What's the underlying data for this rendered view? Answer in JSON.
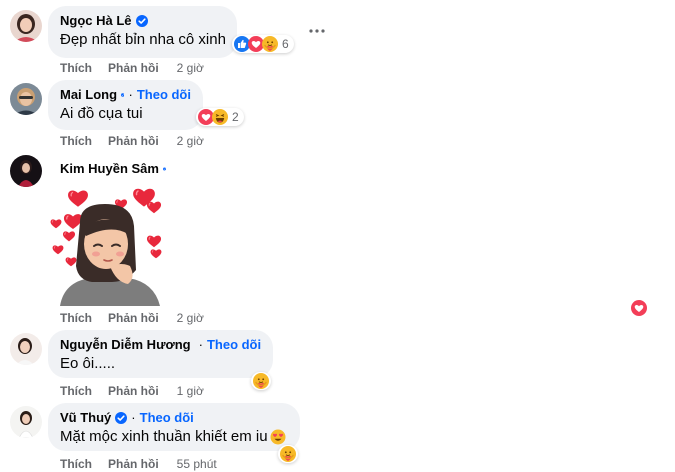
{
  "comments": [
    {
      "name": "Ngọc Hà Lê",
      "text": "Đẹp nhất bỉn nha cô xinh",
      "like": "Thích",
      "reply": "Phản hồi",
      "time": "2 giờ",
      "reaction_count": "6",
      "reactions": [
        "like-icon",
        "love-icon",
        "care-icon"
      ]
    },
    {
      "name": "Mai Long",
      "follow": "Theo dõi",
      "text": "Ai đồ cụa tui",
      "like": "Thích",
      "reply": "Phản hồi",
      "time": "2 giờ",
      "reaction_count": "2",
      "reactions": [
        "love-icon",
        "haha-icon"
      ]
    },
    {
      "name": "Kim Huyền Sâm",
      "sticker": "heart-girl-sticker",
      "like": "Thích",
      "reply": "Phản hồi",
      "time": "2 giờ"
    },
    {
      "name": "Nguyễn Diễm Hương",
      "follow": "Theo dõi",
      "text": "Eo ôi.....",
      "like": "Thích",
      "reply": "Phản hồi",
      "time": "1 giờ",
      "reactions": [
        "care-icon"
      ]
    },
    {
      "name": "Vũ Thuý",
      "follow": "Theo dõi",
      "text": "Mặt mộc xinh thuần khiết em iu",
      "emoji": "heart-eyes-emoji",
      "like": "Thích",
      "reply": "Phản hồi",
      "time": "55 phút",
      "reactions": [
        "care-icon"
      ]
    }
  ],
  "separator": "·",
  "colors": {
    "bubble": "#f0f2f5",
    "link": "#0866ff",
    "meta": "#65676b",
    "love": "#f33e58"
  }
}
